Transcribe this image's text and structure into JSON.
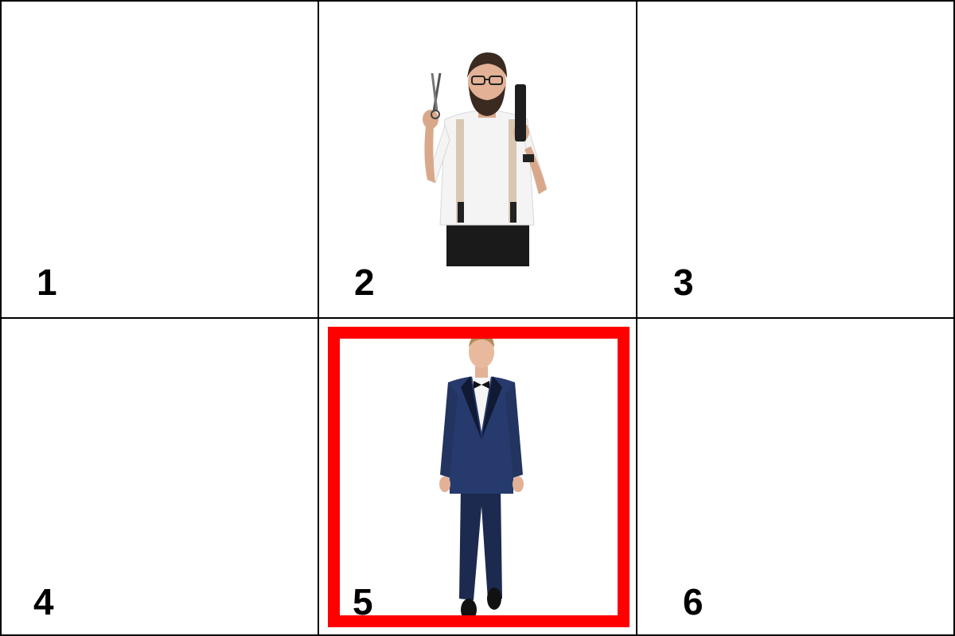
{
  "grid": {
    "cells": [
      {
        "number": "1",
        "image": "empty",
        "selected": false
      },
      {
        "number": "2",
        "image": "bearded-barber-with-scissors-and-comb",
        "selected": false
      },
      {
        "number": "3",
        "image": "empty",
        "selected": false
      },
      {
        "number": "4",
        "image": "empty",
        "selected": false
      },
      {
        "number": "5",
        "image": "man-in-navy-tuxedo",
        "selected": true
      },
      {
        "number": "6",
        "image": "empty",
        "selected": false
      }
    ]
  },
  "colors": {
    "grid_line": "#000000",
    "selection_border": "#ff0000",
    "background": "#ffffff"
  }
}
